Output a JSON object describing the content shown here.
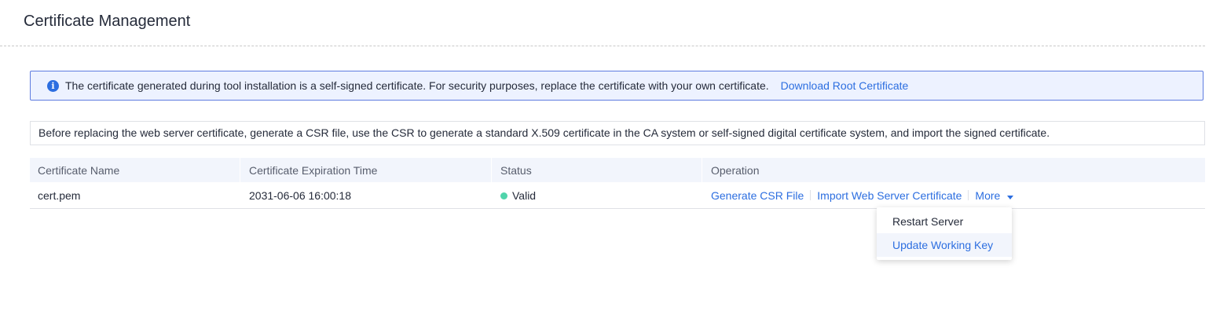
{
  "page": {
    "title": "Certificate Management"
  },
  "notice": {
    "icon": "info-icon",
    "text": "The certificate generated during tool installation is a self-signed certificate. For security purposes, replace the certificate with your own certificate.",
    "link_label": "Download Root Certificate"
  },
  "description": "Before replacing the web server certificate, generate a CSR file, use the CSR to generate a standard X.509 certificate in the CA system or self-signed digital certificate system, and import the signed certificate.",
  "table": {
    "columns": [
      "Certificate Name",
      "Certificate Expiration Time",
      "Status",
      "Operation"
    ],
    "rows": [
      {
        "name": "cert.pem",
        "expiration": "2031-06-06 16:00:18",
        "status": "Valid",
        "status_color": "#50d4ab",
        "operations": {
          "generate_csr": "Generate CSR File",
          "import_cert": "Import Web Server Certificate",
          "more": "More"
        }
      }
    ]
  },
  "more_menu": {
    "items": [
      "Restart Server",
      "Update Working Key"
    ],
    "highlighted": "Update Working Key"
  },
  "colors": {
    "accent": "#2c6ee0",
    "notice_border": "#5e7ce0",
    "notice_bg": "#edf2ff",
    "header_bg": "#f2f5fc",
    "status_valid": "#50d4ab"
  }
}
